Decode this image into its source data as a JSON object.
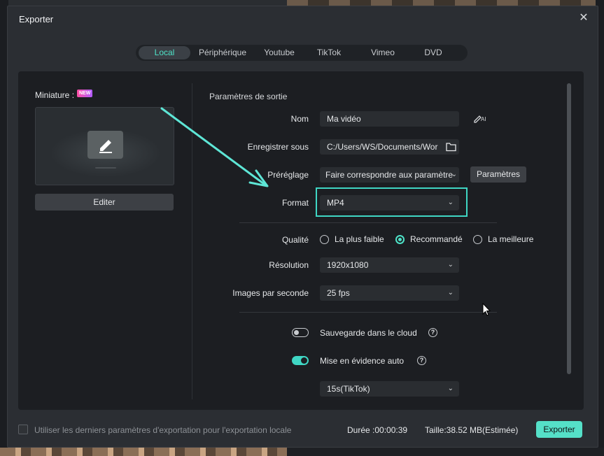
{
  "dialog": {
    "title": "Exporter"
  },
  "tabs": [
    {
      "label": "Local",
      "active": true
    },
    {
      "label": "Périphérique",
      "active": false
    },
    {
      "label": "Youtube",
      "active": false
    },
    {
      "label": "TikTok",
      "active": false
    },
    {
      "label": "Vimeo",
      "active": false
    },
    {
      "label": "DVD",
      "active": false
    }
  ],
  "thumbnail": {
    "label": "Miniature :",
    "badge": "NEW",
    "edit_label": "Editer"
  },
  "settings": {
    "section_title": "Paramètres de sortie",
    "name": {
      "label": "Nom",
      "value": "Ma vidéo",
      "ai_label": "AI"
    },
    "save_to": {
      "label": "Enregistrer sous",
      "value": "C:/Users/WS/Documents/Wor"
    },
    "preset": {
      "label": "Préréglage",
      "value": "Faire correspondre aux paramètre",
      "button": "Paramètres"
    },
    "format": {
      "label": "Format",
      "value": "MP4"
    },
    "quality": {
      "label": "Qualité",
      "options": [
        "La plus faible",
        "Recommandé",
        "La meilleure"
      ],
      "selected": "Recommandé"
    },
    "resolution": {
      "label": "Résolution",
      "value": "1920x1080"
    },
    "fps": {
      "label": "Images par seconde",
      "value": "25 fps"
    },
    "cloud_backup": {
      "label": "Sauvegarde dans le cloud",
      "enabled": false
    },
    "auto_highlight": {
      "label": "Mise en évidence auto",
      "enabled": true,
      "duration": "15s(TikTok)"
    }
  },
  "footer": {
    "checkbox_label": "Utiliser les derniers paramètres d'exportation pour l'exportation locale",
    "duration": "Durée :00:00:39",
    "size": "Taille:38.52 MB(Estimée)",
    "export_label": "Exporter"
  },
  "colors": {
    "accent": "#4ee3c8",
    "highlight_border": "#3fd6c4",
    "panel": "#1c1e22",
    "dialog": "#2b2e33"
  },
  "icons": [
    "close-icon",
    "pencil-icon",
    "ai-pen-icon",
    "folder-icon",
    "chevron-down-icon",
    "help-icon",
    "annotation-arrow",
    "mouse-cursor"
  ]
}
